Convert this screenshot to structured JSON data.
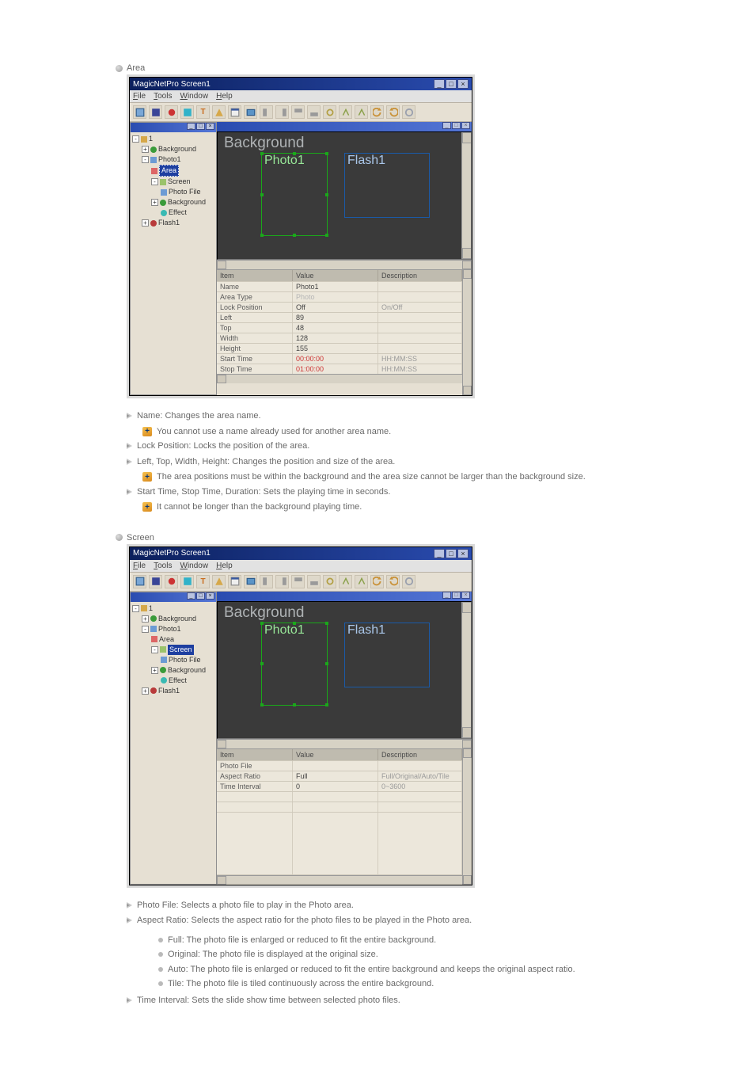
{
  "sections": {
    "area": "Area",
    "screen": "Screen"
  },
  "app": {
    "title": "MagicNetPro Screen1",
    "menus": [
      "File",
      "Tools",
      "Window",
      "Help"
    ]
  },
  "tree": {
    "root": "1",
    "nodes": {
      "background": "Background",
      "photo1": "Photo1",
      "area": "Area",
      "screen": "Screen",
      "photo_file": "Photo File",
      "background2": "Background",
      "effect": "Effect",
      "flash1": "Flash1"
    }
  },
  "preview": {
    "bg_label": "Background",
    "photo_label": "Photo1",
    "flash_label": "Flash1"
  },
  "prop_headers": {
    "item": "Item",
    "value": "Value",
    "desc": "Description"
  },
  "area_props": [
    {
      "item": "Name",
      "value": "Photo1",
      "desc": ""
    },
    {
      "item": "Area Type",
      "value": "Photo",
      "desc": "",
      "disabled": true
    },
    {
      "item": "Lock Position",
      "value": "Off",
      "desc": "On/Off"
    },
    {
      "item": "Left",
      "value": "89",
      "desc": ""
    },
    {
      "item": "Top",
      "value": "48",
      "desc": ""
    },
    {
      "item": "Width",
      "value": "128",
      "desc": ""
    },
    {
      "item": "Height",
      "value": "155",
      "desc": ""
    },
    {
      "item": "Start Time",
      "value": "00:00:00",
      "desc": "HH:MM:SS"
    },
    {
      "item": "Stop Time",
      "value": "01:00:00",
      "desc": "HH:MM:SS",
      "cut": true
    }
  ],
  "screen_props": [
    {
      "item": "Photo File",
      "value": "",
      "desc": ""
    },
    {
      "item": "Aspect Ratio",
      "value": "Full",
      "desc": "Full/Original/Auto/Tile"
    },
    {
      "item": "Time Interval",
      "value": "0",
      "desc": "0~3600"
    }
  ],
  "area_notes": {
    "n1": "Name: Changes the area name.",
    "n1a": "You cannot use a name already used for another area name.",
    "n2": "Lock Position: Locks the position of the area.",
    "n3": "Left, Top, Width, Height: Changes the position and size of the area.",
    "n3a": "The area positions must be within the background and the area size cannot be larger than the background size.",
    "n4": "Start Time, Stop Time, Duration: Sets the playing time in seconds.",
    "n4a": "It cannot be longer than the background playing time."
  },
  "screen_notes": {
    "n1": "Photo File: Selects a photo file to play in the Photo area.",
    "n2": "Aspect Ratio: Selects the aspect ratio for the photo files to be played in the Photo area.",
    "b1": "Full: The photo file is enlarged or reduced to fit the entire background.",
    "b2": "Original: The photo file is displayed at the original size.",
    "b3": "Auto: The photo file is enlarged or reduced to fit the entire background and keeps the original aspect ratio.",
    "b4": "Tile: The photo file is tiled continuously across the entire background.",
    "n3": "Time Interval: Sets the slide show time between selected photo files."
  }
}
